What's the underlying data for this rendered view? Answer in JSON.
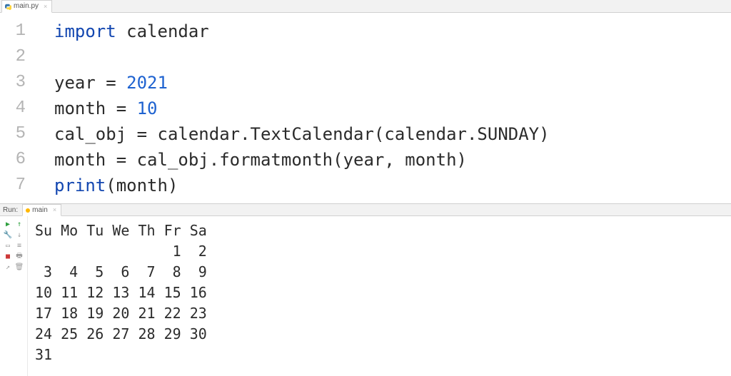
{
  "tab": {
    "filename": "main.py",
    "icon_name": "python-file-icon"
  },
  "editor": {
    "line_numbers": [
      "1",
      "2",
      "3",
      "4",
      "5",
      "6",
      "7"
    ],
    "code_tokens": [
      [
        {
          "t": "import ",
          "c": "kw"
        },
        {
          "t": "calendar",
          "c": "txt"
        }
      ],
      [
        {
          "t": "",
          "c": "txt"
        }
      ],
      [
        {
          "t": "year = ",
          "c": "txt"
        },
        {
          "t": "2021",
          "c": "num"
        }
      ],
      [
        {
          "t": "month = ",
          "c": "txt"
        },
        {
          "t": "10",
          "c": "num"
        }
      ],
      [
        {
          "t": "cal_obj = calendar.TextCalendar(calendar.SUNDAY)",
          "c": "txt"
        }
      ],
      [
        {
          "t": "month = cal_obj.formatmonth(year, month)",
          "c": "txt"
        }
      ],
      [
        {
          "t": "print",
          "c": "kw"
        },
        {
          "t": "(month)",
          "c": "txt"
        }
      ]
    ]
  },
  "run": {
    "label": "Run:",
    "tab_label": "main",
    "output": "Su Mo Tu We Th Fr Sa\n                1  2\n 3  4  5  6  7  8  9\n10 11 12 13 14 15 16\n17 18 19 20 21 22 23\n24 25 26 27 28 29 30\n31"
  },
  "icons": {
    "play": "▶",
    "wrench": "🔧",
    "down": "↓",
    "up": "↑",
    "doublebar": "≡",
    "overline": "▭",
    "stop": "■",
    "print": "🖶",
    "export": "↗",
    "trash": "🗑"
  }
}
